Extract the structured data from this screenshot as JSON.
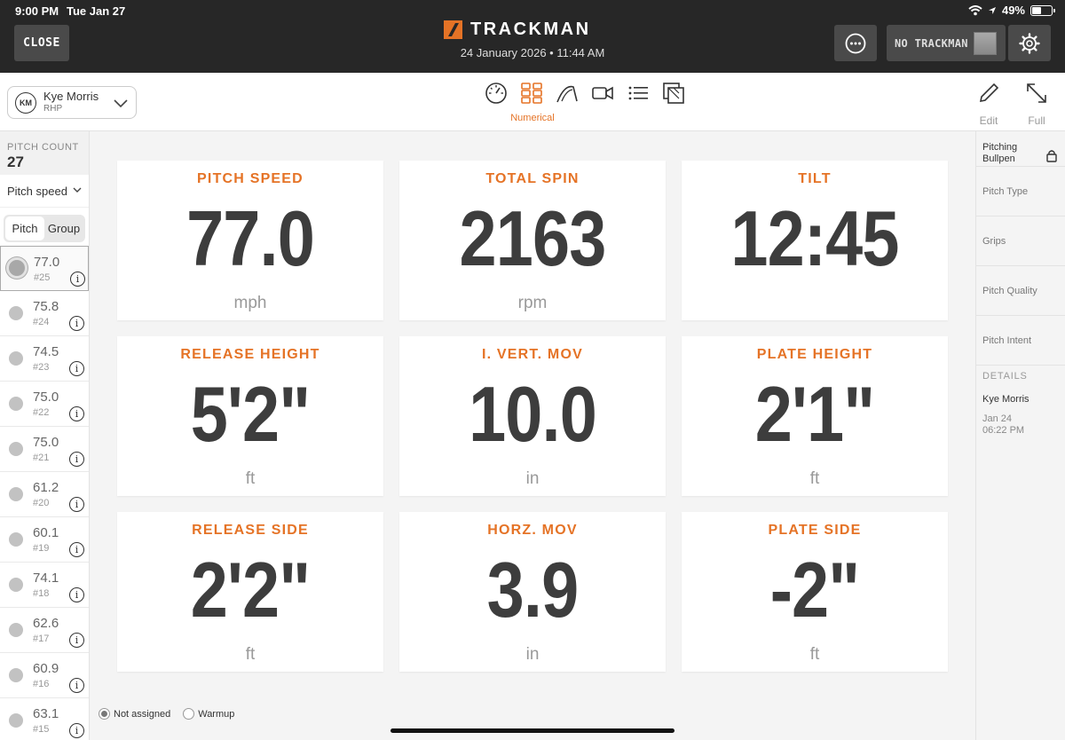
{
  "status_bar": {
    "time": "9:00 PM",
    "date": "Tue Jan 27",
    "battery": "49%",
    "battery_level": 0.49
  },
  "header": {
    "close_label": "CLOSE",
    "logo_text": "TRACKMAN",
    "session_datetime": "24 January 2026 • 11:44 AM",
    "device_label": "NO TRACKMAN",
    "icons": [
      "more-options-icon",
      "settings-gear-icon"
    ]
  },
  "player": {
    "initials": "KM",
    "name": "Kye Morris",
    "hand": "RHP"
  },
  "views": {
    "icons": [
      "gauge-icon",
      "grid-numerical-icon",
      "trajectory-icon",
      "video-icon",
      "list-icon",
      "strike-zone-icon"
    ],
    "active_label": "Numerical"
  },
  "tools": {
    "edit_label": "Edit",
    "full_label": "Full"
  },
  "sidebar": {
    "pitch_count_label": "PITCH COUNT",
    "pitch_count": "27",
    "metric": "Pitch speed",
    "seg_pitch": "Pitch",
    "seg_group": "Group",
    "pitches": [
      {
        "value": "77.0",
        "num": "#25"
      },
      {
        "value": "75.8",
        "num": "#24"
      },
      {
        "value": "74.5",
        "num": "#23"
      },
      {
        "value": "75.0",
        "num": "#22"
      },
      {
        "value": "75.0",
        "num": "#21"
      },
      {
        "value": "61.2",
        "num": "#20"
      },
      {
        "value": "60.1",
        "num": "#19"
      },
      {
        "value": "74.1",
        "num": "#18"
      },
      {
        "value": "62.6",
        "num": "#17"
      },
      {
        "value": "60.9",
        "num": "#16"
      },
      {
        "value": "63.1",
        "num": "#15"
      }
    ]
  },
  "metrics": [
    {
      "title": "PITCH SPEED",
      "value": "77.0",
      "unit": "mph"
    },
    {
      "title": "TOTAL SPIN",
      "value": "2163",
      "unit": "rpm"
    },
    {
      "title": "TILT",
      "value": "12:45",
      "unit": ""
    },
    {
      "title": "RELEASE HEIGHT",
      "value": "5'2\"",
      "unit": "ft"
    },
    {
      "title": "I. VERT. MOV",
      "value": "10.0",
      "unit": "in"
    },
    {
      "title": "PLATE HEIGHT",
      "value": "2'1\"",
      "unit": "ft"
    },
    {
      "title": "RELEASE SIDE",
      "value": "2'2\"",
      "unit": "ft"
    },
    {
      "title": "HORZ. MOV",
      "value": "3.9",
      "unit": "in"
    },
    {
      "title": "PLATE SIDE",
      "value": "-2\"",
      "unit": "ft"
    }
  ],
  "assignment": {
    "option1": "Not assigned",
    "option2": "Warmup"
  },
  "right_panel": {
    "title_line1": "Pitching",
    "title_line2": "Bullpen",
    "items": [
      "Pitch Type",
      "Grips",
      "Pitch Quality",
      "Pitch Intent"
    ],
    "details_label": "DETAILS",
    "details_name": "Kye Morris",
    "details_date": "Jan 24",
    "details_time": "06:22 PM"
  },
  "colors": {
    "accent": "#E57326",
    "header_bg": "#272727",
    "value_text": "#3D3D3D"
  }
}
